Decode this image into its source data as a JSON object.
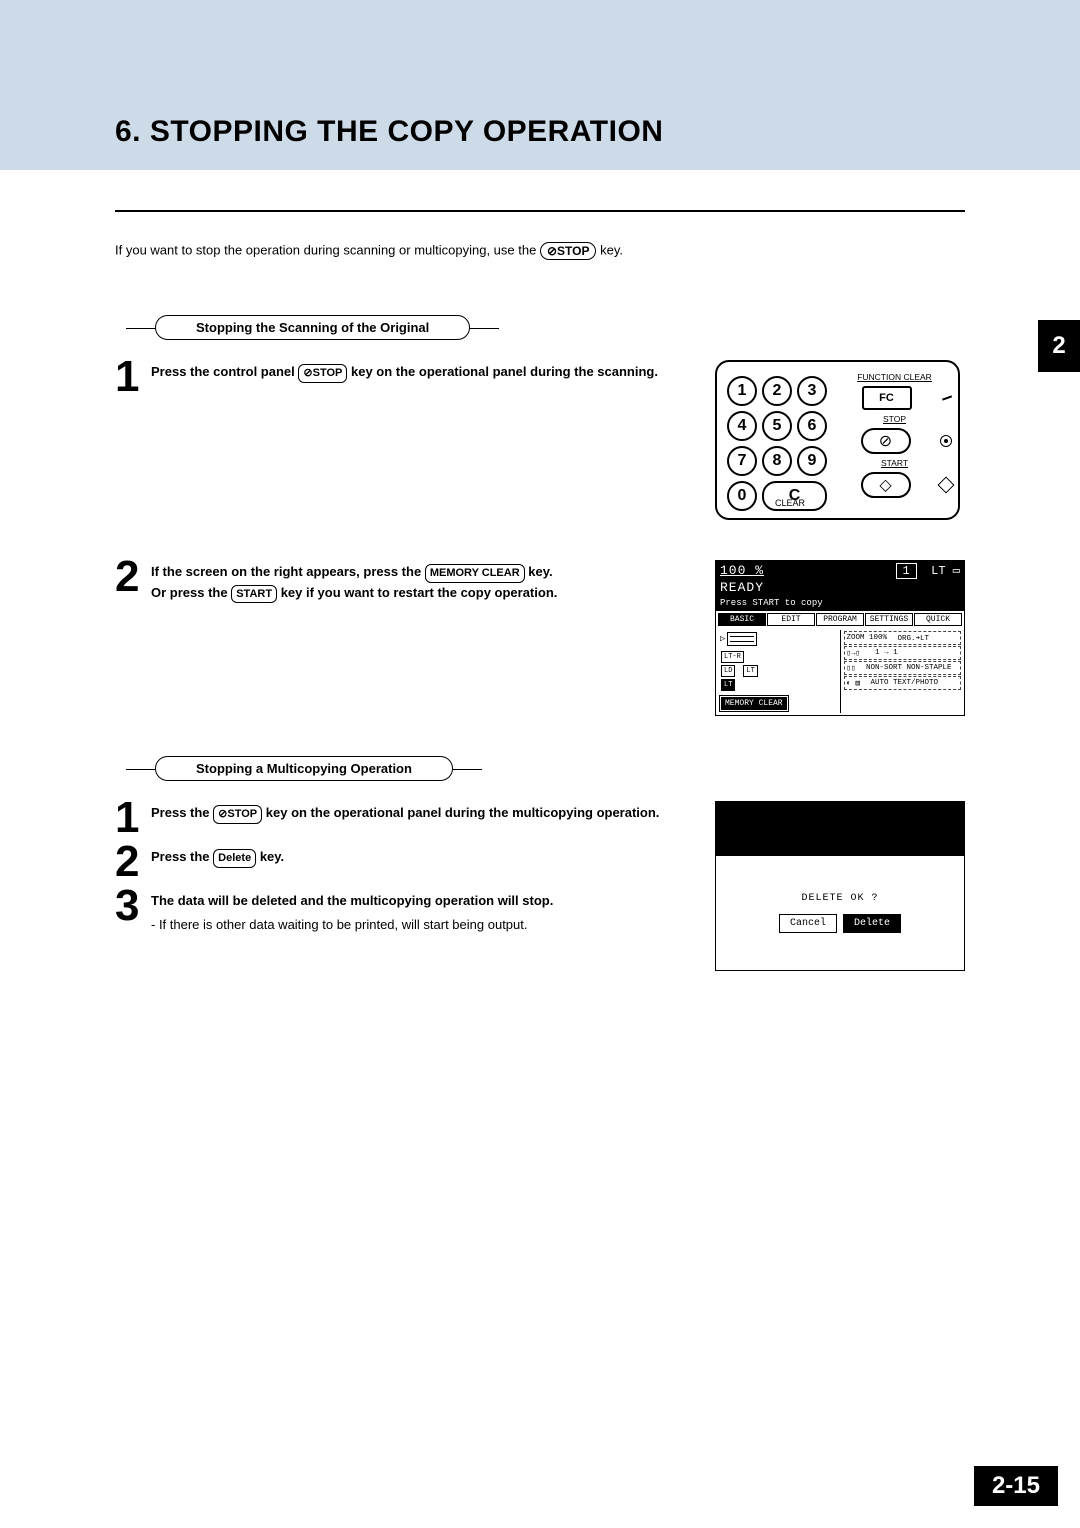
{
  "header": {
    "title": "6. STOPPING THE COPY OPERATION"
  },
  "chapter_tab": "2",
  "page_number": "2-15",
  "intro": {
    "before": "If you want to stop the operation during scanning or multicopying, use the",
    "stop_key": "⊘STOP",
    "after": "key."
  },
  "section_a": {
    "heading": "Stopping the Scanning of the Original",
    "step1": {
      "num": "1",
      "t1": "Press the control panel",
      "key": "⊘STOP",
      "t2": "key on the operational panel during the scanning."
    },
    "step2": {
      "num": "2",
      "t1": "If the screen on the right appears, press the",
      "key1": "MEMORY CLEAR",
      "t2": "key.",
      "t3": "Or press the",
      "key2": "START",
      "t4": "key if you want to restart the copy operation."
    }
  },
  "section_b": {
    "heading": "Stopping a Multicopying Operation",
    "step1": {
      "num": "1",
      "t1": "Press the",
      "key": "⊘STOP",
      "t2": "key on the operational panel during the multicopying operation."
    },
    "step2": {
      "num": "2",
      "t1": "Press the",
      "key": "Delete",
      "t2": "key."
    },
    "step3": {
      "num": "3",
      "t1": "The data will be deleted and the multicopying operation will stop.",
      "note": "- If there is other data waiting to be printed, will start being output."
    }
  },
  "panel": {
    "keys": [
      "1",
      "2",
      "3",
      "4",
      "5",
      "6",
      "7",
      "8",
      "9",
      "0"
    ],
    "c": "C",
    "clear": "CLEAR",
    "function_clear": "FUNCTION CLEAR",
    "fc": "FC",
    "stop": "STOP",
    "start": "START"
  },
  "lcd1": {
    "pct": "100 %",
    "count": "1",
    "lt": "LT",
    "ready": "READY",
    "msg": "Press START to copy",
    "tabs": [
      "BASIC",
      "EDIT",
      "PROGRAM",
      "SETTINGS",
      "QUICK"
    ],
    "zoom": "ZOOM 100%",
    "org": "ORG.➔LT",
    "oneone": "1 → 1",
    "nonsort": "NON-SORT NON-STAPLE",
    "auto": "AUTO TEXT/PHOTO",
    "ltr": "LT-R",
    "ld": "LD",
    "lt2": "LT",
    "lt3": "LT",
    "mem": "MEMORY CLEAR"
  },
  "lcd2": {
    "question": "DELETE OK ?",
    "cancel": "Cancel",
    "delete": "Delete"
  }
}
